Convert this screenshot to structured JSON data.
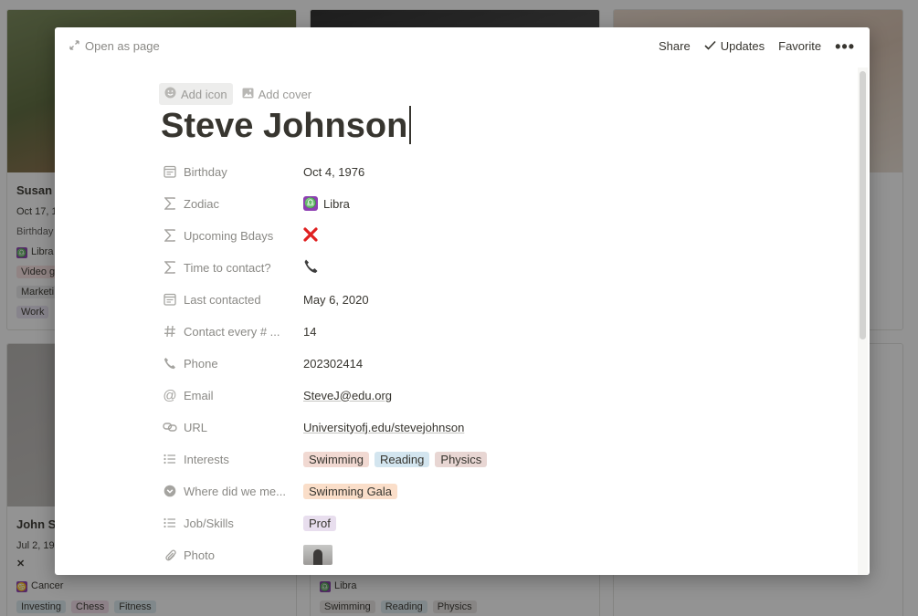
{
  "gallery": {
    "card1": {
      "title": "Susan L",
      "date": "Oct 17, 1",
      "birthday": "Birthday",
      "zodiac": "Libra",
      "tags": [
        "Video g",
        "Marketi",
        "Work"
      ]
    },
    "card4": {
      "title": "John S",
      "date": "Jul 2, 19",
      "zodiac": "Cancer",
      "tags": [
        "Investing",
        "Chess",
        "Fitness"
      ]
    },
    "card5": {
      "zodiac": "Libra",
      "tags": [
        "Swimming",
        "Reading",
        "Physics"
      ]
    }
  },
  "modal": {
    "open_as_page": "Open as page",
    "share": "Share",
    "updates": "Updates",
    "favorite": "Favorite",
    "more": "•••",
    "add_icon": "Add icon",
    "add_cover": "Add cover",
    "title": "Steve Johnson"
  },
  "properties": [
    {
      "name": "Birthday",
      "icon": "calendar-icon",
      "value": "Oct 4, 1976"
    },
    {
      "name": "Zodiac",
      "icon": "formula-icon",
      "value": "Libra",
      "badge": "♎"
    },
    {
      "name": "Upcoming Bdays",
      "icon": "formula-icon",
      "value": "❌"
    },
    {
      "name": "Time to contact?",
      "icon": "formula-icon",
      "value": "📞"
    },
    {
      "name": "Last contacted",
      "icon": "calendar-icon",
      "value": "May 6, 2020"
    },
    {
      "name": "Contact every # ...",
      "icon": "hash-icon",
      "value": "14"
    },
    {
      "name": "Phone",
      "icon": "phone-icon",
      "value": "202302414"
    },
    {
      "name": "Email",
      "icon": "at-icon",
      "value": "SteveJ@edu.org"
    },
    {
      "name": "URL",
      "icon": "link-icon",
      "value": "Universityofj.edu/stevejohnson"
    },
    {
      "name": "Interests",
      "icon": "list-icon",
      "values": [
        "Swimming",
        "Reading",
        "Physics"
      ]
    },
    {
      "name": "Where did we me...",
      "icon": "circle-chevron-icon",
      "values": [
        "Swimming Gala"
      ]
    },
    {
      "name": "Job/Skills",
      "icon": "list-icon",
      "values": [
        "Prof"
      ]
    },
    {
      "name": "Photo",
      "icon": "paperclip-icon",
      "value": ""
    }
  ],
  "colors": {
    "accent_red": "#e02020",
    "zodiac_purple": "#8e3fb3"
  }
}
